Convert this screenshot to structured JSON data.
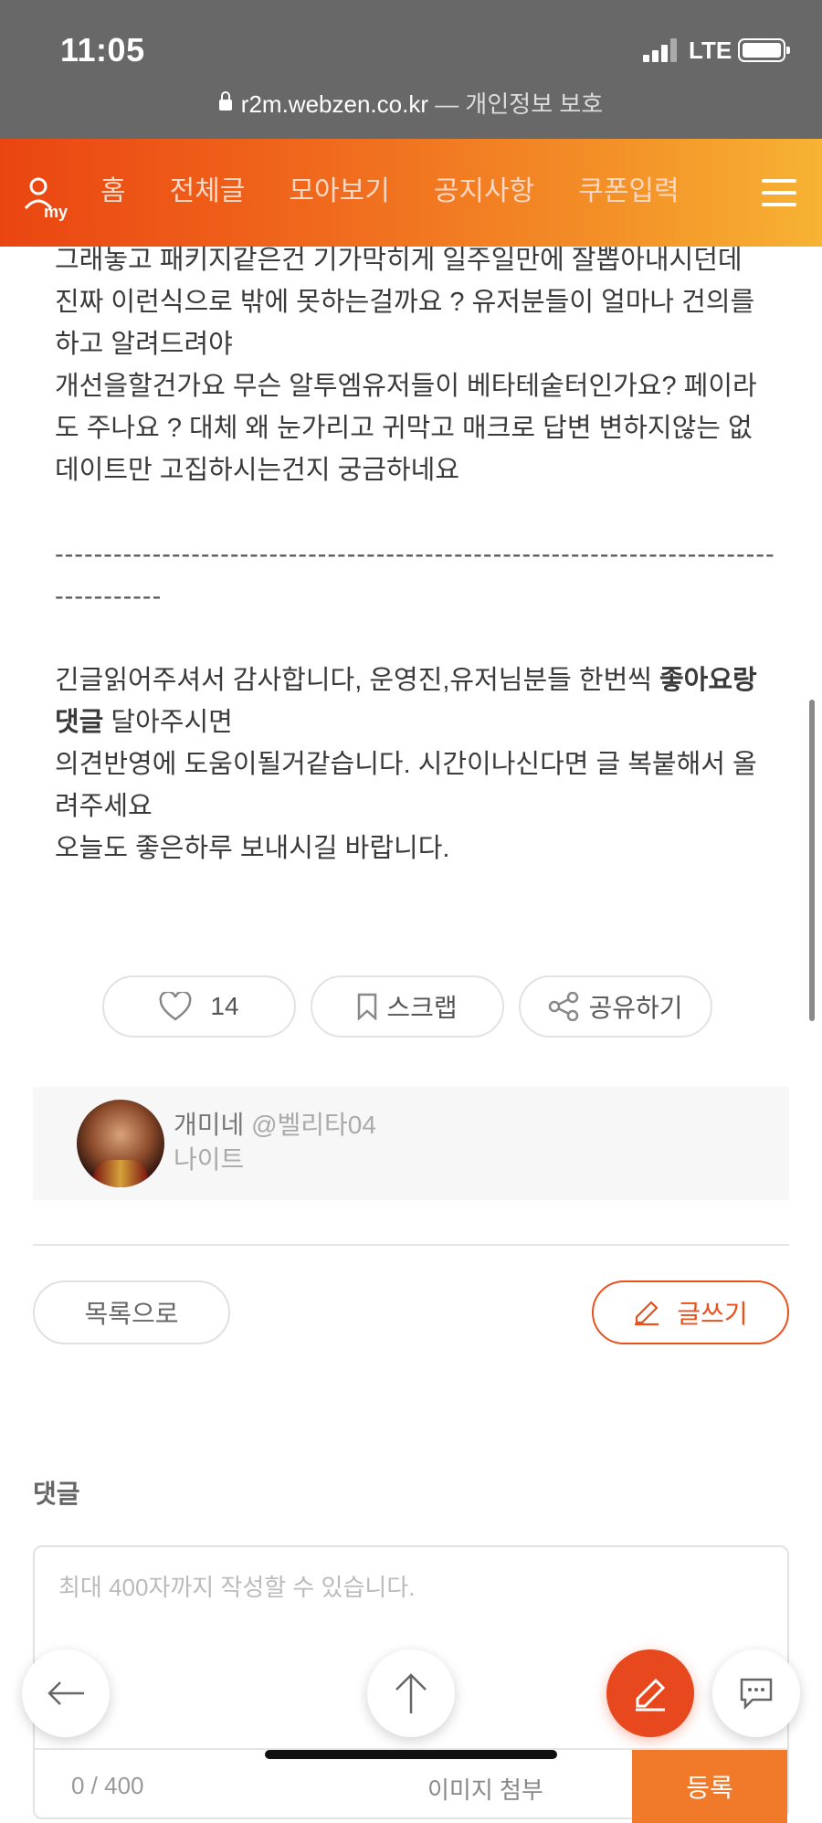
{
  "status_bar": {
    "time": "11:05",
    "network": "LTE"
  },
  "url_bar": {
    "domain": "r2m.webzen.co.kr",
    "suffix": " — 개인정보 보호"
  },
  "nav": {
    "tabs": [
      "홈",
      "전체글",
      "모아보기",
      "공지사항",
      "쿠폰입력"
    ],
    "my_label": "my"
  },
  "article": {
    "lines_a": [
      "그래놓고 패키지같은건 기가막히게 일주일만에 잘뽑아내시던데",
      "진짜 이런식으로 밖에 못하는걸까요 ? 유저분들이 얼마나 건의를 하고 알려드려야",
      "개선을할건가요 무슨 알투엠유저들이 베타테숱터인가요? 페이라도 주나요 ? 대체 왜 눈가리고 귀막고 매크로 답변 변하지않는 없데이트만 고집하시는건지 궁금하네요"
    ],
    "dashes": "-------------------------------------------------------------------------------------",
    "closing_pre": "긴글읽어주셔서 감사합니다, 운영진,유저님분들 한번씩 ",
    "closing_bold": "좋아요랑 댓글",
    "closing_post": " 달아주시면",
    "closing_2": "의견반영에 도움이될거같습니다. 시간이나신다면 글 복붙해서 올려주세요",
    "closing_3": "오늘도 좋은하루 보내시길 바랍니다."
  },
  "actions": {
    "like_count": "14",
    "scrap_label": "스크랩",
    "share_label": "공유하기"
  },
  "author": {
    "name": "개미네",
    "handle": "@벨리타04",
    "class": "나이트"
  },
  "buttons": {
    "list_label": "목록으로",
    "write_label": "글쓰기"
  },
  "comments": {
    "title": "댓글",
    "placeholder": "최대 400자까지 작성할 수 있습니다.",
    "counter": "0 / 400",
    "image_attach": "이미지 첨부",
    "submit": "등록"
  },
  "colors": {
    "accent": "#e8481e",
    "nav_start": "#ea4511",
    "nav_end": "#f7b333"
  }
}
